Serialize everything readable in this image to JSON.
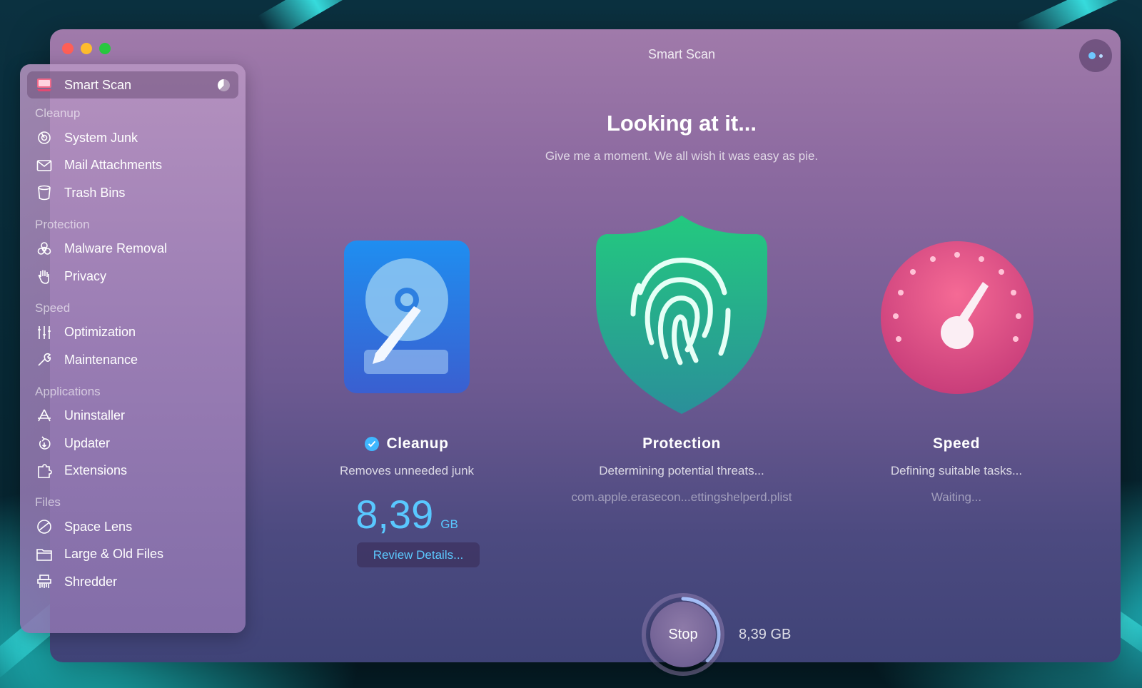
{
  "window": {
    "title": "Smart Scan"
  },
  "sidebar": {
    "active": {
      "label": "Smart Scan",
      "icon": "smart-scan-icon"
    },
    "sections": [
      {
        "title": "Cleanup",
        "items": [
          {
            "label": "System Junk",
            "icon": "system-junk-icon"
          },
          {
            "label": "Mail Attachments",
            "icon": "mail-icon"
          },
          {
            "label": "Trash Bins",
            "icon": "trash-icon"
          }
        ]
      },
      {
        "title": "Protection",
        "items": [
          {
            "label": "Malware Removal",
            "icon": "biohazard-icon"
          },
          {
            "label": "Privacy",
            "icon": "hand-icon"
          }
        ]
      },
      {
        "title": "Speed",
        "items": [
          {
            "label": "Optimization",
            "icon": "sliders-icon"
          },
          {
            "label": "Maintenance",
            "icon": "wrench-icon"
          }
        ]
      },
      {
        "title": "Applications",
        "items": [
          {
            "label": "Uninstaller",
            "icon": "uninstaller-icon"
          },
          {
            "label": "Updater",
            "icon": "updater-icon"
          },
          {
            "label": "Extensions",
            "icon": "extensions-icon"
          }
        ]
      },
      {
        "title": "Files",
        "items": [
          {
            "label": "Space Lens",
            "icon": "space-lens-icon"
          },
          {
            "label": "Large & Old Files",
            "icon": "folder-icon"
          },
          {
            "label": "Shredder",
            "icon": "shredder-icon"
          }
        ]
      }
    ]
  },
  "main": {
    "headline": "Looking at it...",
    "subline": "Give me a moment. We all wish it was easy as pie.",
    "cleanup": {
      "title": "Cleanup",
      "description": "Removes unneeded junk",
      "size": "8,39",
      "unit": "GB",
      "review_label": "Review Details..."
    },
    "protection": {
      "title": "Protection",
      "description": "Determining potential threats...",
      "status": "com.apple.erasecon...ettingshelperd.plist"
    },
    "speed": {
      "title": "Speed",
      "description": "Defining suitable tasks...",
      "status": "Waiting..."
    }
  },
  "footer": {
    "stop_label": "Stop",
    "progress_fraction": 0.38,
    "total_size": "8,39 GB"
  },
  "colors": {
    "accent_blue": "#59c8ff",
    "protection_green": "#23c07f",
    "speed_pink": "#e0457e"
  }
}
